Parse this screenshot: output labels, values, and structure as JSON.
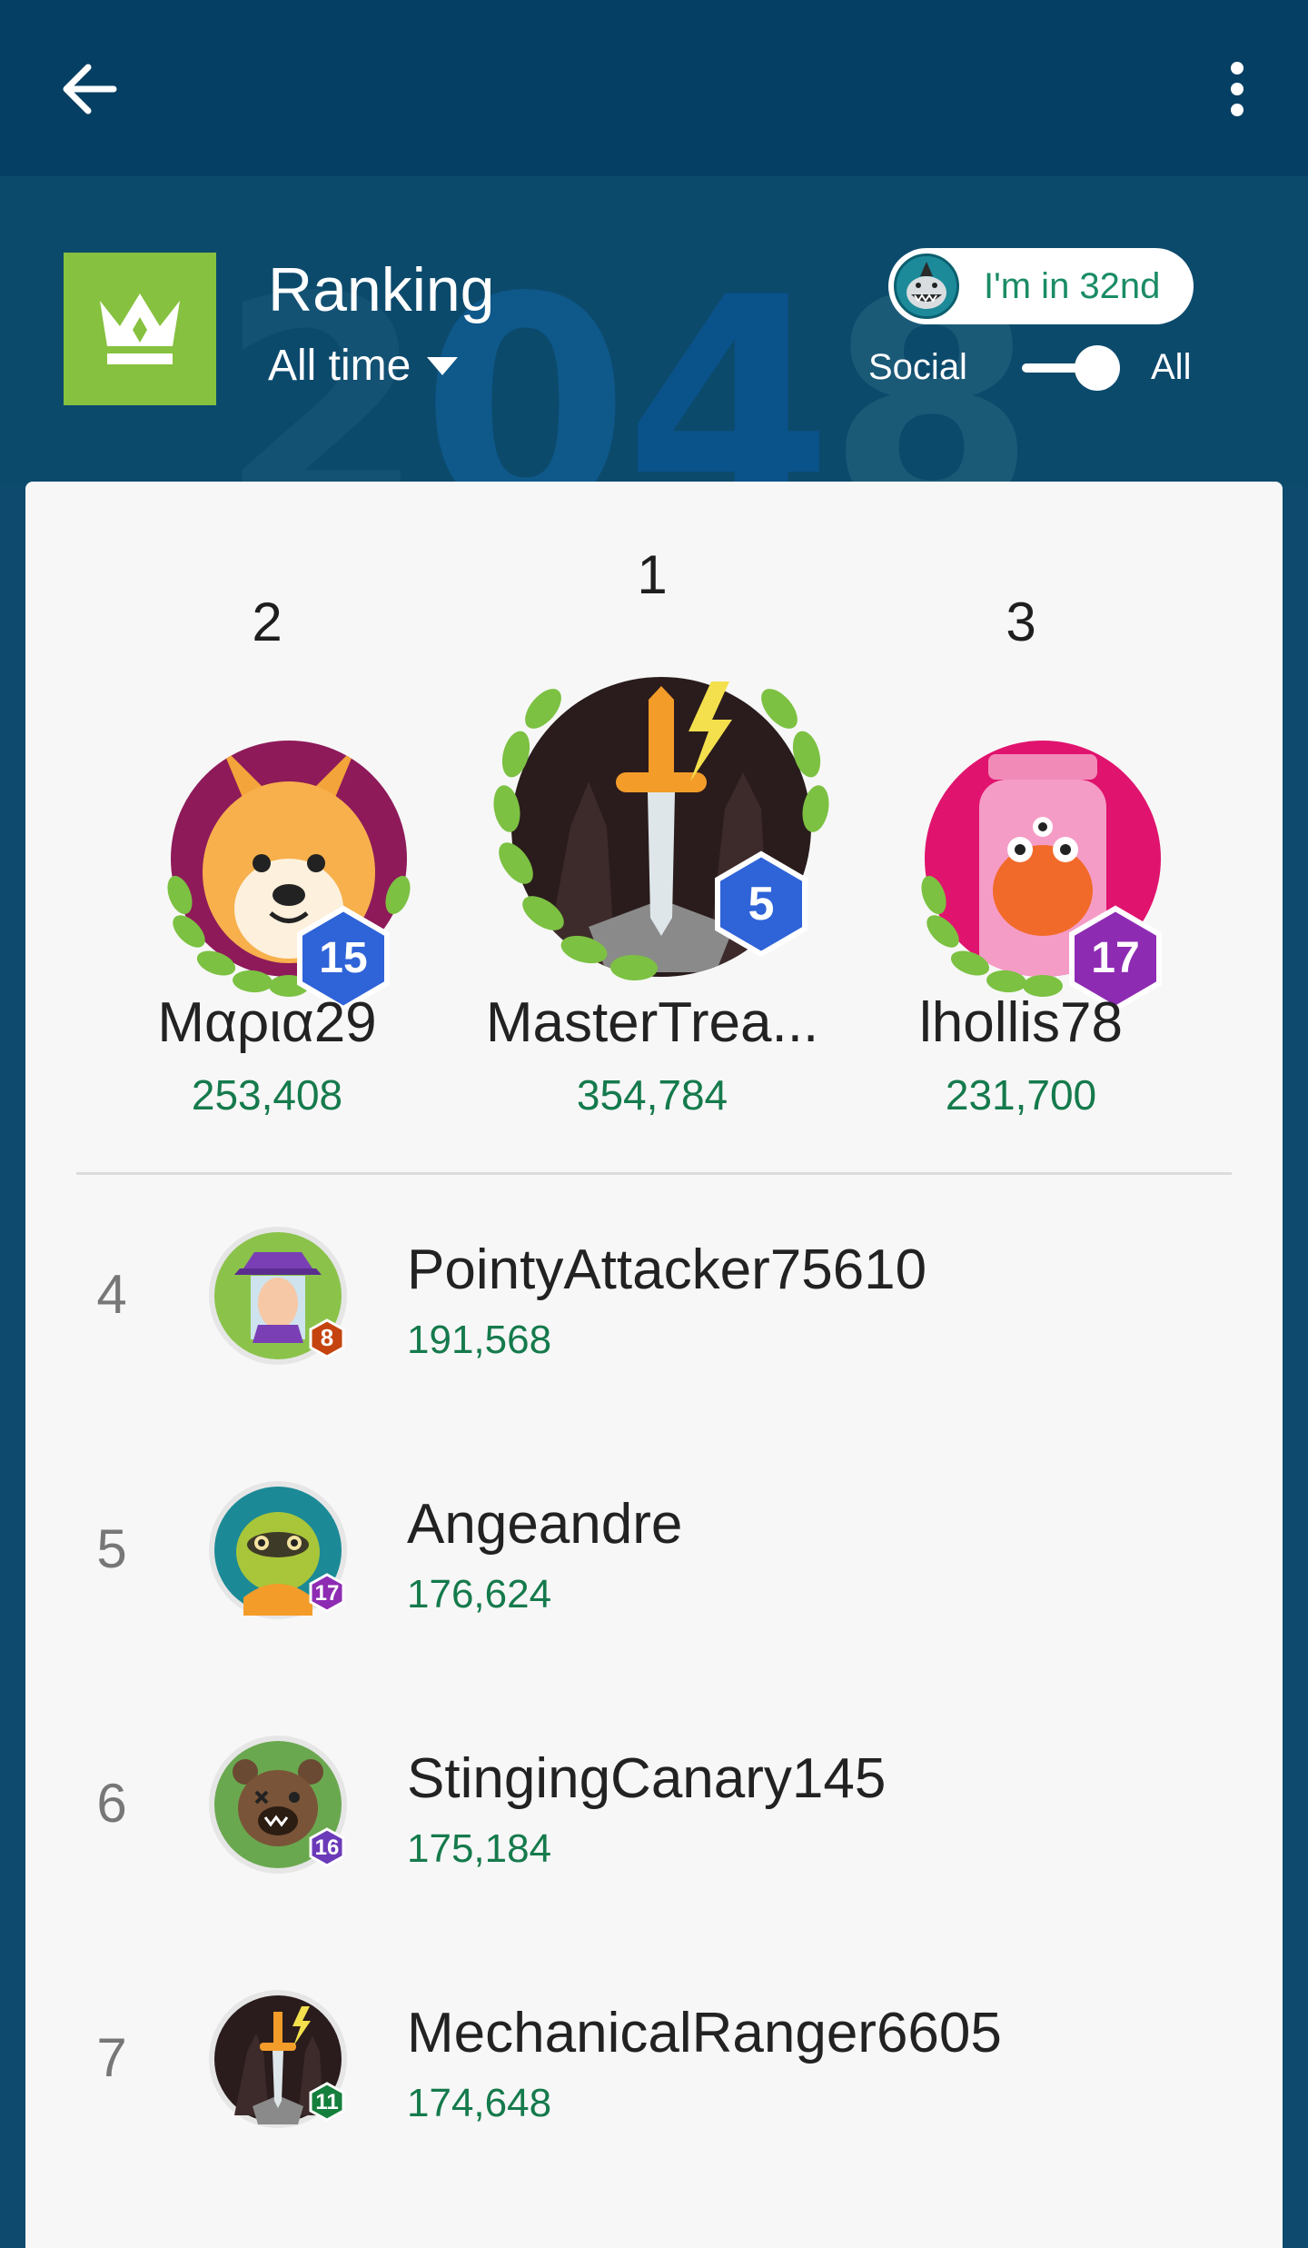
{
  "app": {
    "background_word": [
      "2",
      "0",
      "4",
      "8"
    ]
  },
  "header": {
    "title": "Ranking",
    "period": "All time",
    "my_rank": "I'm in 32nd",
    "social_label": "Social",
    "all_label": "All"
  },
  "podium": [
    {
      "rank": "2",
      "name": "Μαρια29",
      "score": "253,408",
      "level": "15",
      "avatar": "doge-icon"
    },
    {
      "rank": "1",
      "name": "MasterTrea...",
      "score": "354,784",
      "level": "5",
      "avatar": "sword-icon"
    },
    {
      "rank": "3",
      "name": "lhollis78",
      "score": "231,700",
      "level": "17",
      "avatar": "jar-monster-icon"
    }
  ],
  "rows": [
    {
      "rank": "4",
      "name": "PointyAttacker75610",
      "score": "191,568",
      "level": "8",
      "badge_color": "#c4430e",
      "avatar": "wizard-icon"
    },
    {
      "rank": "5",
      "name": "Angeandre",
      "score": "176,624",
      "level": "17",
      "badge_color": "#8e2bb3",
      "avatar": "sloth-icon"
    },
    {
      "rank": "6",
      "name": "StingingCanary145",
      "score": "175,184",
      "level": "16",
      "badge_color": "#6a3ab8",
      "avatar": "bear-icon"
    },
    {
      "rank": "7",
      "name": "MechanicalRanger6605",
      "score": "174,648",
      "level": "11",
      "badge_color": "#15803d",
      "avatar": "sword-icon"
    }
  ],
  "colors": {
    "accent": "#157a4c",
    "topbar": "#053f63",
    "crown": "#86c13f",
    "level_blue": "#2f63d8",
    "level_purple": "#8e2bb3"
  }
}
